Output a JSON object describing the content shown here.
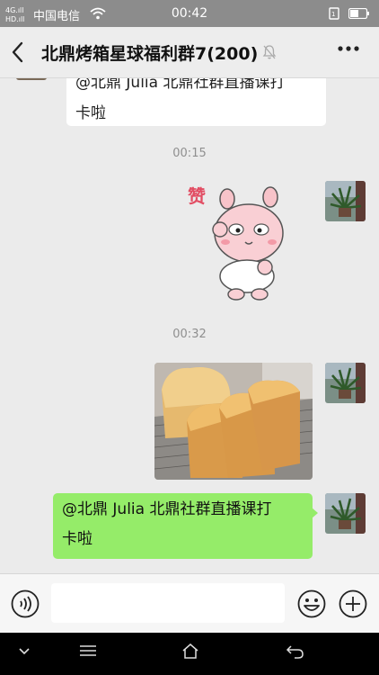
{
  "status_bar": {
    "carrier": "中国电信",
    "time": "00:42"
  },
  "header": {
    "title": "北鼎烤箱星球福利群7(200)"
  },
  "messages": {
    "incoming_text": "@北鼎 Julia  北鼎社群直播课打\n卡啦",
    "time_1": "00:15",
    "time_2": "00:32",
    "outgoing_text": "@北鼎 Julia  北鼎社群直播课打\n卡啦",
    "sticker_caption": "赞"
  },
  "input": {
    "placeholder": ""
  },
  "colors": {
    "outgoing_bubble": "#95ec69",
    "incoming_bubble": "#ffffff",
    "chat_background": "#ebebeb"
  },
  "icons": {
    "back": "chevron-left-icon",
    "mute": "mute-bell-icon",
    "more": "more-dots-icon",
    "voice": "voice-icon",
    "emoji": "emoji-icon",
    "plus": "plus-icon"
  }
}
